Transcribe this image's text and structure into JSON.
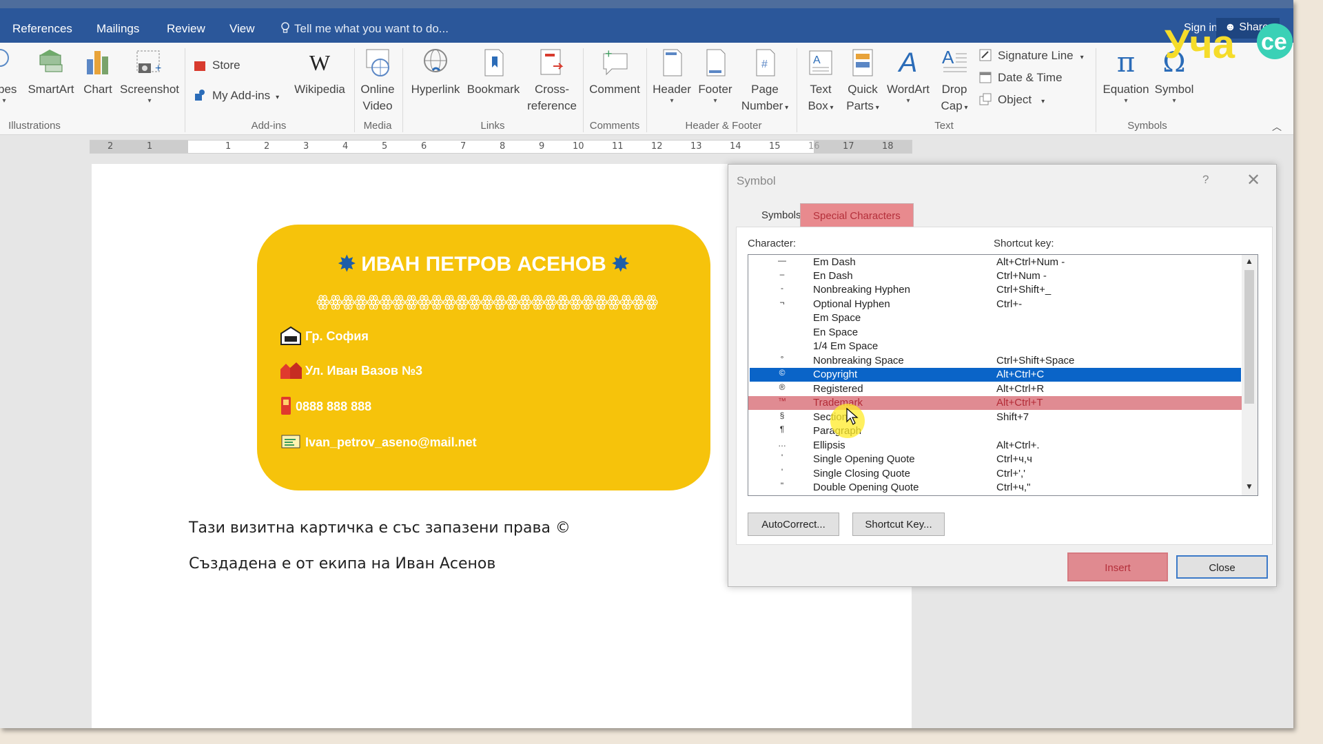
{
  "tabs": [
    "References",
    "Mailings",
    "Review",
    "View"
  ],
  "tell_me": "Tell me what you want to do...",
  "account": {
    "sign_in": "Sign in",
    "share": "Share"
  },
  "logo_text": "Уча се",
  "ribbon": {
    "illustrations": {
      "shapes": "apes",
      "smartart": "SmartArt",
      "chart": "Chart",
      "screenshot": "Screenshot",
      "group": "Illustrations"
    },
    "addins": {
      "store": "Store",
      "my_addins": "My Add-ins",
      "wikipedia": "Wikipedia",
      "group": "Add-ins"
    },
    "media": {
      "online_video_1": "Online",
      "online_video_2": "Video",
      "group": "Media"
    },
    "links": {
      "hyperlink": "Hyperlink",
      "bookmark": "Bookmark",
      "cross_ref_1": "Cross-",
      "cross_ref_2": "reference",
      "group": "Links"
    },
    "comments": {
      "comment": "Comment",
      "group": "Comments"
    },
    "header_footer": {
      "header": "Header",
      "footer": "Footer",
      "page_number_1": "Page",
      "page_number_2": "Number",
      "group": "Header & Footer"
    },
    "text": {
      "text_box_1": "Text",
      "text_box_2": "Box",
      "quick_parts_1": "Quick",
      "quick_parts_2": "Parts",
      "wordart": "WordArt",
      "drop_cap_1": "Drop",
      "drop_cap_2": "Cap",
      "signature_line": "Signature Line",
      "date_time": "Date & Time",
      "object": "Object",
      "group": "Text"
    },
    "symbols": {
      "equation": "Equation",
      "symbol": "Symbol",
      "group": "Symbols"
    }
  },
  "ruler": {
    "left_numbers": [
      "2",
      "1"
    ],
    "right_numbers": [
      "1",
      "2",
      "3",
      "4",
      "5",
      "6",
      "7",
      "8",
      "9",
      "10",
      "11",
      "12",
      "13",
      "14",
      "15",
      "16",
      "17",
      "18"
    ]
  },
  "card": {
    "name": "ИВАН ПЕТРОВ АСЕНОВ",
    "star": "✸",
    "decoration": "ꙮꙮꙮꙮꙮꙮꙮꙮꙮꙮꙮꙮꙮꙮꙮꙮꙮꙮꙮꙮꙮꙮꙮꙮꙮꙮꙮ",
    "city": "Гр. София",
    "street": "Ул. Иван Вазов №3",
    "phone": "0888 888 888",
    "email": "Ivan_petrov_aseno@mail.net"
  },
  "doc_text": {
    "line1": "Тази визитна картичка е със запазени права ©",
    "line2": "Създадена е от екипа на Иван Асенов"
  },
  "dialog": {
    "title": "Symbol",
    "help": "?",
    "close_x": "✕",
    "tab_symbols": "Symbols",
    "tab_special": "Special Characters",
    "col_character": "Character:",
    "col_shortcut": "Shortcut key:",
    "rows": [
      {
        "glyph": "—",
        "name": "Em Dash",
        "shortcut": "Alt+Ctrl+Num -"
      },
      {
        "glyph": "–",
        "name": "En Dash",
        "shortcut": "Ctrl+Num -"
      },
      {
        "glyph": "-",
        "name": "Nonbreaking Hyphen",
        "shortcut": "Ctrl+Shift+_"
      },
      {
        "glyph": "¬",
        "name": "Optional Hyphen",
        "shortcut": "Ctrl+-"
      },
      {
        "glyph": "",
        "name": "Em Space",
        "shortcut": ""
      },
      {
        "glyph": "",
        "name": "En Space",
        "shortcut": ""
      },
      {
        "glyph": "",
        "name": "1/4 Em Space",
        "shortcut": ""
      },
      {
        "glyph": "°",
        "name": "Nonbreaking Space",
        "shortcut": "Ctrl+Shift+Space"
      },
      {
        "glyph": "©",
        "name": "Copyright",
        "shortcut": "Alt+Ctrl+C"
      },
      {
        "glyph": "®",
        "name": "Registered",
        "shortcut": "Alt+Ctrl+R"
      },
      {
        "glyph": "™",
        "name": "Trademark",
        "shortcut": "Alt+Ctrl+T"
      },
      {
        "glyph": "§",
        "name": "Section",
        "shortcut": "Shift+7"
      },
      {
        "glyph": "¶",
        "name": "Paragraph",
        "shortcut": ""
      },
      {
        "glyph": "…",
        "name": "Ellipsis",
        "shortcut": "Alt+Ctrl+."
      },
      {
        "glyph": "'",
        "name": "Single Opening Quote",
        "shortcut": "Ctrl+ч,ч"
      },
      {
        "glyph": "'",
        "name": "Single Closing Quote",
        "shortcut": "Ctrl+','"
      },
      {
        "glyph": "\"",
        "name": "Double Opening Quote",
        "shortcut": "Ctrl+ч,\""
      }
    ],
    "selected_row": "Copyright",
    "highlighted_row": "Trademark",
    "btn_autocorrect": "AutoCorrect...",
    "btn_shortcut": "Shortcut Key...",
    "btn_insert": "Insert",
    "btn_close": "Close"
  },
  "colors": {
    "word_blue": "#2b579a",
    "card_yellow": "#f6c30b",
    "selection_blue": "#0a64c8",
    "highlight_pink": "#e08b92"
  }
}
